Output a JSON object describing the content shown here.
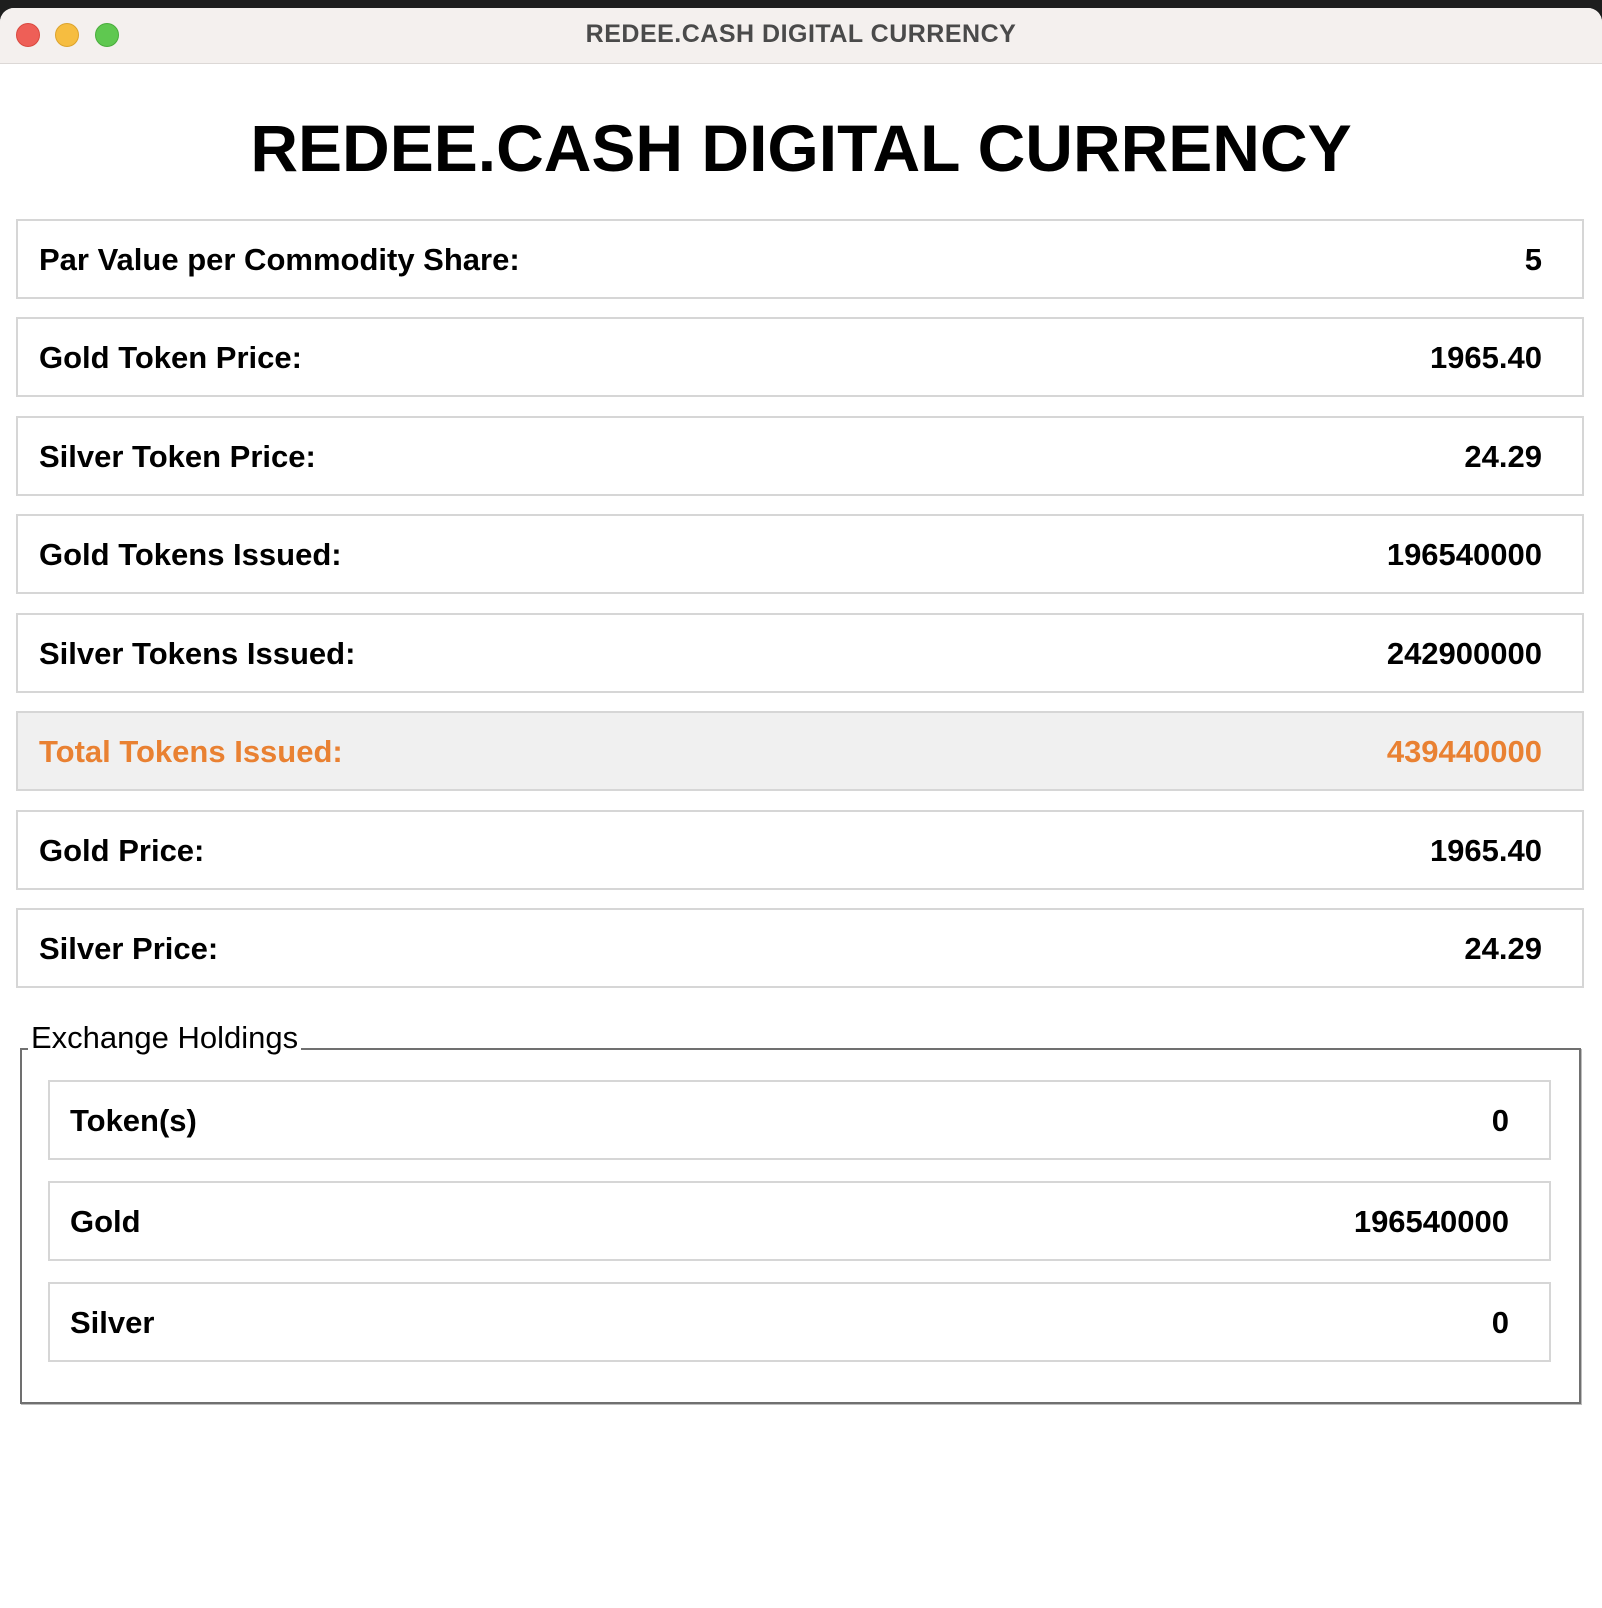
{
  "window": {
    "title": "REDEE.CASH DIGITAL CURRENCY"
  },
  "heading": "REDEE.CASH DIGITAL CURRENCY",
  "rows": [
    {
      "label": "Par Value per Commodity Share:",
      "value": "5"
    },
    {
      "label": "Gold Token Price:",
      "value": "1965.40"
    },
    {
      "label": "Silver Token Price:",
      "value": "24.29"
    },
    {
      "label": "Gold Tokens Issued:",
      "value": "196540000"
    },
    {
      "label": "Silver Tokens Issued:",
      "value": "242900000"
    },
    {
      "label": "Total Tokens Issued:",
      "value": "439440000"
    },
    {
      "label": "Gold Price:",
      "value": "1965.40"
    },
    {
      "label": "Silver Price:",
      "value": "24.29"
    }
  ],
  "exchange_holdings": {
    "title": "Exchange Holdings",
    "items": [
      {
        "label": "Token(s)",
        "value": "0"
      },
      {
        "label": "Gold",
        "value": "196540000"
      },
      {
        "label": "Silver",
        "value": "0"
      }
    ]
  },
  "colors": {
    "highlight_text": "#e98132",
    "highlight_bg": "#f0f0f0"
  }
}
